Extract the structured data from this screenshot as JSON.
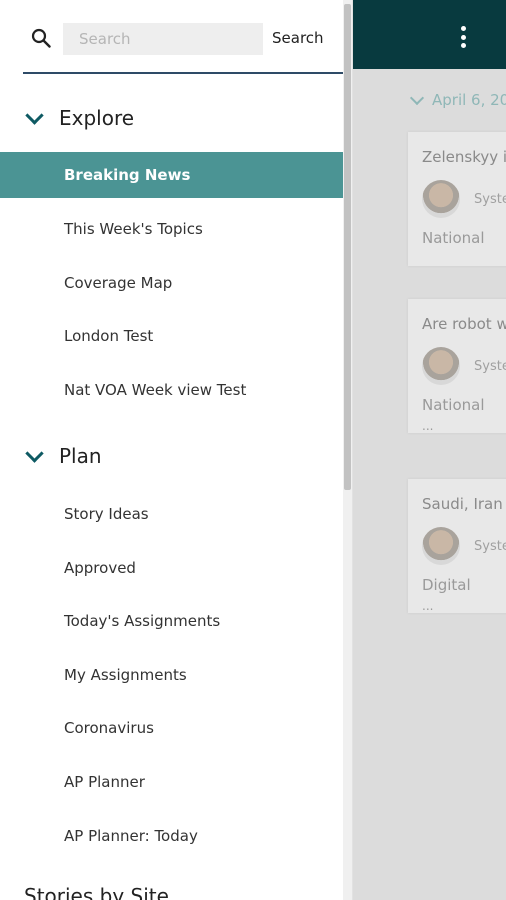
{
  "search": {
    "placeholder": "Search",
    "button_label": "Search"
  },
  "sections": {
    "explore": {
      "title": "Explore",
      "items": [
        "Breaking News",
        "This Week's Topics",
        "Coverage Map",
        "London Test",
        "Nat VOA Week view Test"
      ]
    },
    "plan": {
      "title": "Plan",
      "items": [
        "Story Ideas",
        "Approved",
        "Today's Assignments",
        "My Assignments",
        "Coronavirus",
        "AP Planner",
        "AP Planner: Today"
      ]
    },
    "next_partial": "Stories by Site"
  },
  "background": {
    "date": "April 6, 20",
    "cards": [
      {
        "title": "Zelenskyy i",
        "author": "Syste",
        "category": "National",
        "ellipsis": ""
      },
      {
        "title": "Are robot w",
        "author": "Syste",
        "category": "National",
        "ellipsis": "..."
      },
      {
        "title": "Saudi, Iran",
        "author": "Syste",
        "category": "Digital",
        "ellipsis": "..."
      }
    ]
  },
  "colors": {
    "active_bg": "#4b9494",
    "topbar": "#083a3f",
    "accent_chevron": "#0e5a63"
  }
}
